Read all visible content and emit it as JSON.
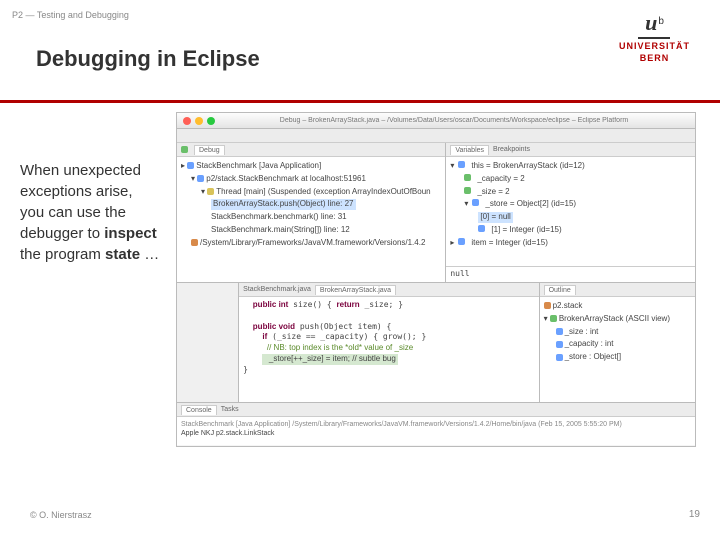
{
  "header": {
    "crumb": "P2 — Testing and Debugging",
    "title": "Debugging in Eclipse"
  },
  "logo": {
    "u": "u",
    "b": "b",
    "line1": "UNIVERSITÄT",
    "line2": "BERN"
  },
  "body": {
    "p1": "When unexpected exceptions arise, you can use the debugger to ",
    "strong1": "inspect",
    "p2": " the program ",
    "strong2": "state",
    "p3": " …"
  },
  "footer": {
    "left": "© O. Nierstrasz",
    "right": "19"
  },
  "ide": {
    "window_title": "Debug – BrokenArrayStack.java – /Volumes/Data/Users/oscar/Documents/Workspace/eclipse – Eclipse Platform",
    "debug_tab": "Debug",
    "vars_tab": "Variables",
    "bp_tab": "Breakpoints",
    "outline_tab": "Outline",
    "console_tab": "Console",
    "tasks_tab": "Tasks",
    "editor_tab1": "StackBenchmark.java",
    "editor_tab2": "BrokenArrayStack.java",
    "debug_tree": {
      "l0": "StackBenchmark [Java Application]",
      "l1": "p2/stack.StackBenchmark at localhost:51961",
      "l2": "Thread [main] (Suspended (exception ArrayIndexOutOfBoun",
      "l3": "BrokenArrayStack.push(Object) line: 27",
      "l4": "StackBenchmark.benchmark() line: 31",
      "l5": "StackBenchmark.main(String[]) line: 12",
      "l6": "/System/Library/Frameworks/JavaVM.framework/Versions/1.4.2"
    },
    "vars": {
      "v0": "this = BrokenArrayStack  (id=12)",
      "v1": "_capacity = 2",
      "v2": "_size = 2",
      "v3": "_store = Object[2]  (id=15)",
      "v4": "[0] = null",
      "v5": "[1] = Integer  (id=15)",
      "v6": "item = Integer  (id=15)",
      "bottom": "null"
    },
    "code": {
      "c0": "public int size() { return _size; }",
      "c1": "public void push(Object item) {",
      "c2": "  if (_size == _capacity) { grow(); }",
      "c3": "  // NB: top index is the *old* value of _size",
      "c4": "  _store[++_size] = item; // subtle bug",
      "c5": "}"
    },
    "outline": {
      "o0": "p2.stack",
      "o1": "BrokenArrayStack  (ASCII view)",
      "o2": "_size : int",
      "o3": "_capacity : int",
      "o4": "_store : Object[]"
    },
    "console_line": "StackBenchmark [Java Application] /System/Library/Frameworks/JavaVM.framework/Versions/1.4.2/Home/bin/java (Feb 15, 2005 5:55:20 PM)",
    "console_out": "Apple NKJ        p2.stack.LinkStack"
  }
}
